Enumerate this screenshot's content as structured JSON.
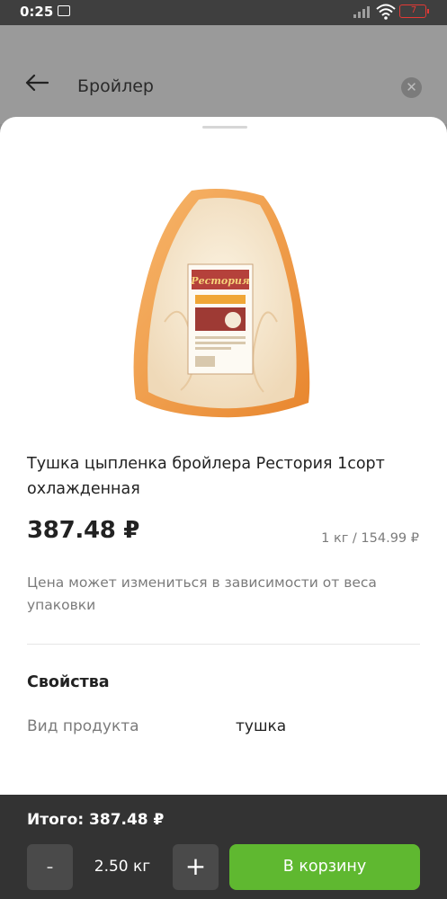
{
  "status_bar": {
    "time": "0:25",
    "battery_level": "7",
    "battery_color": "#e53935",
    "icons": [
      "notification-icon",
      "signal-icon",
      "wifi-icon",
      "battery-icon"
    ]
  },
  "search_header": {
    "query": "Бройлер",
    "icons": [
      "back-arrow-icon",
      "clear-icon"
    ]
  },
  "product": {
    "image_label": "Рестория",
    "title": "Тушка цыпленка бройлера Рестория 1сорт охлажденная",
    "price": "387.48 ₽",
    "unit_price": "1 кг / 154.99 ₽",
    "price_note": "Цена может измениться в зависимости от веса упаковки"
  },
  "properties": {
    "title": "Свойства",
    "items": [
      {
        "name": "Вид продукта",
        "value": "тушка"
      }
    ]
  },
  "cart_bar": {
    "total": "Итого: 387.48 ₽",
    "minus_label": "-",
    "quantity": "2.50 кг",
    "plus_label": "+",
    "add_label": "В корзину",
    "accent_color": "#5fb830"
  }
}
